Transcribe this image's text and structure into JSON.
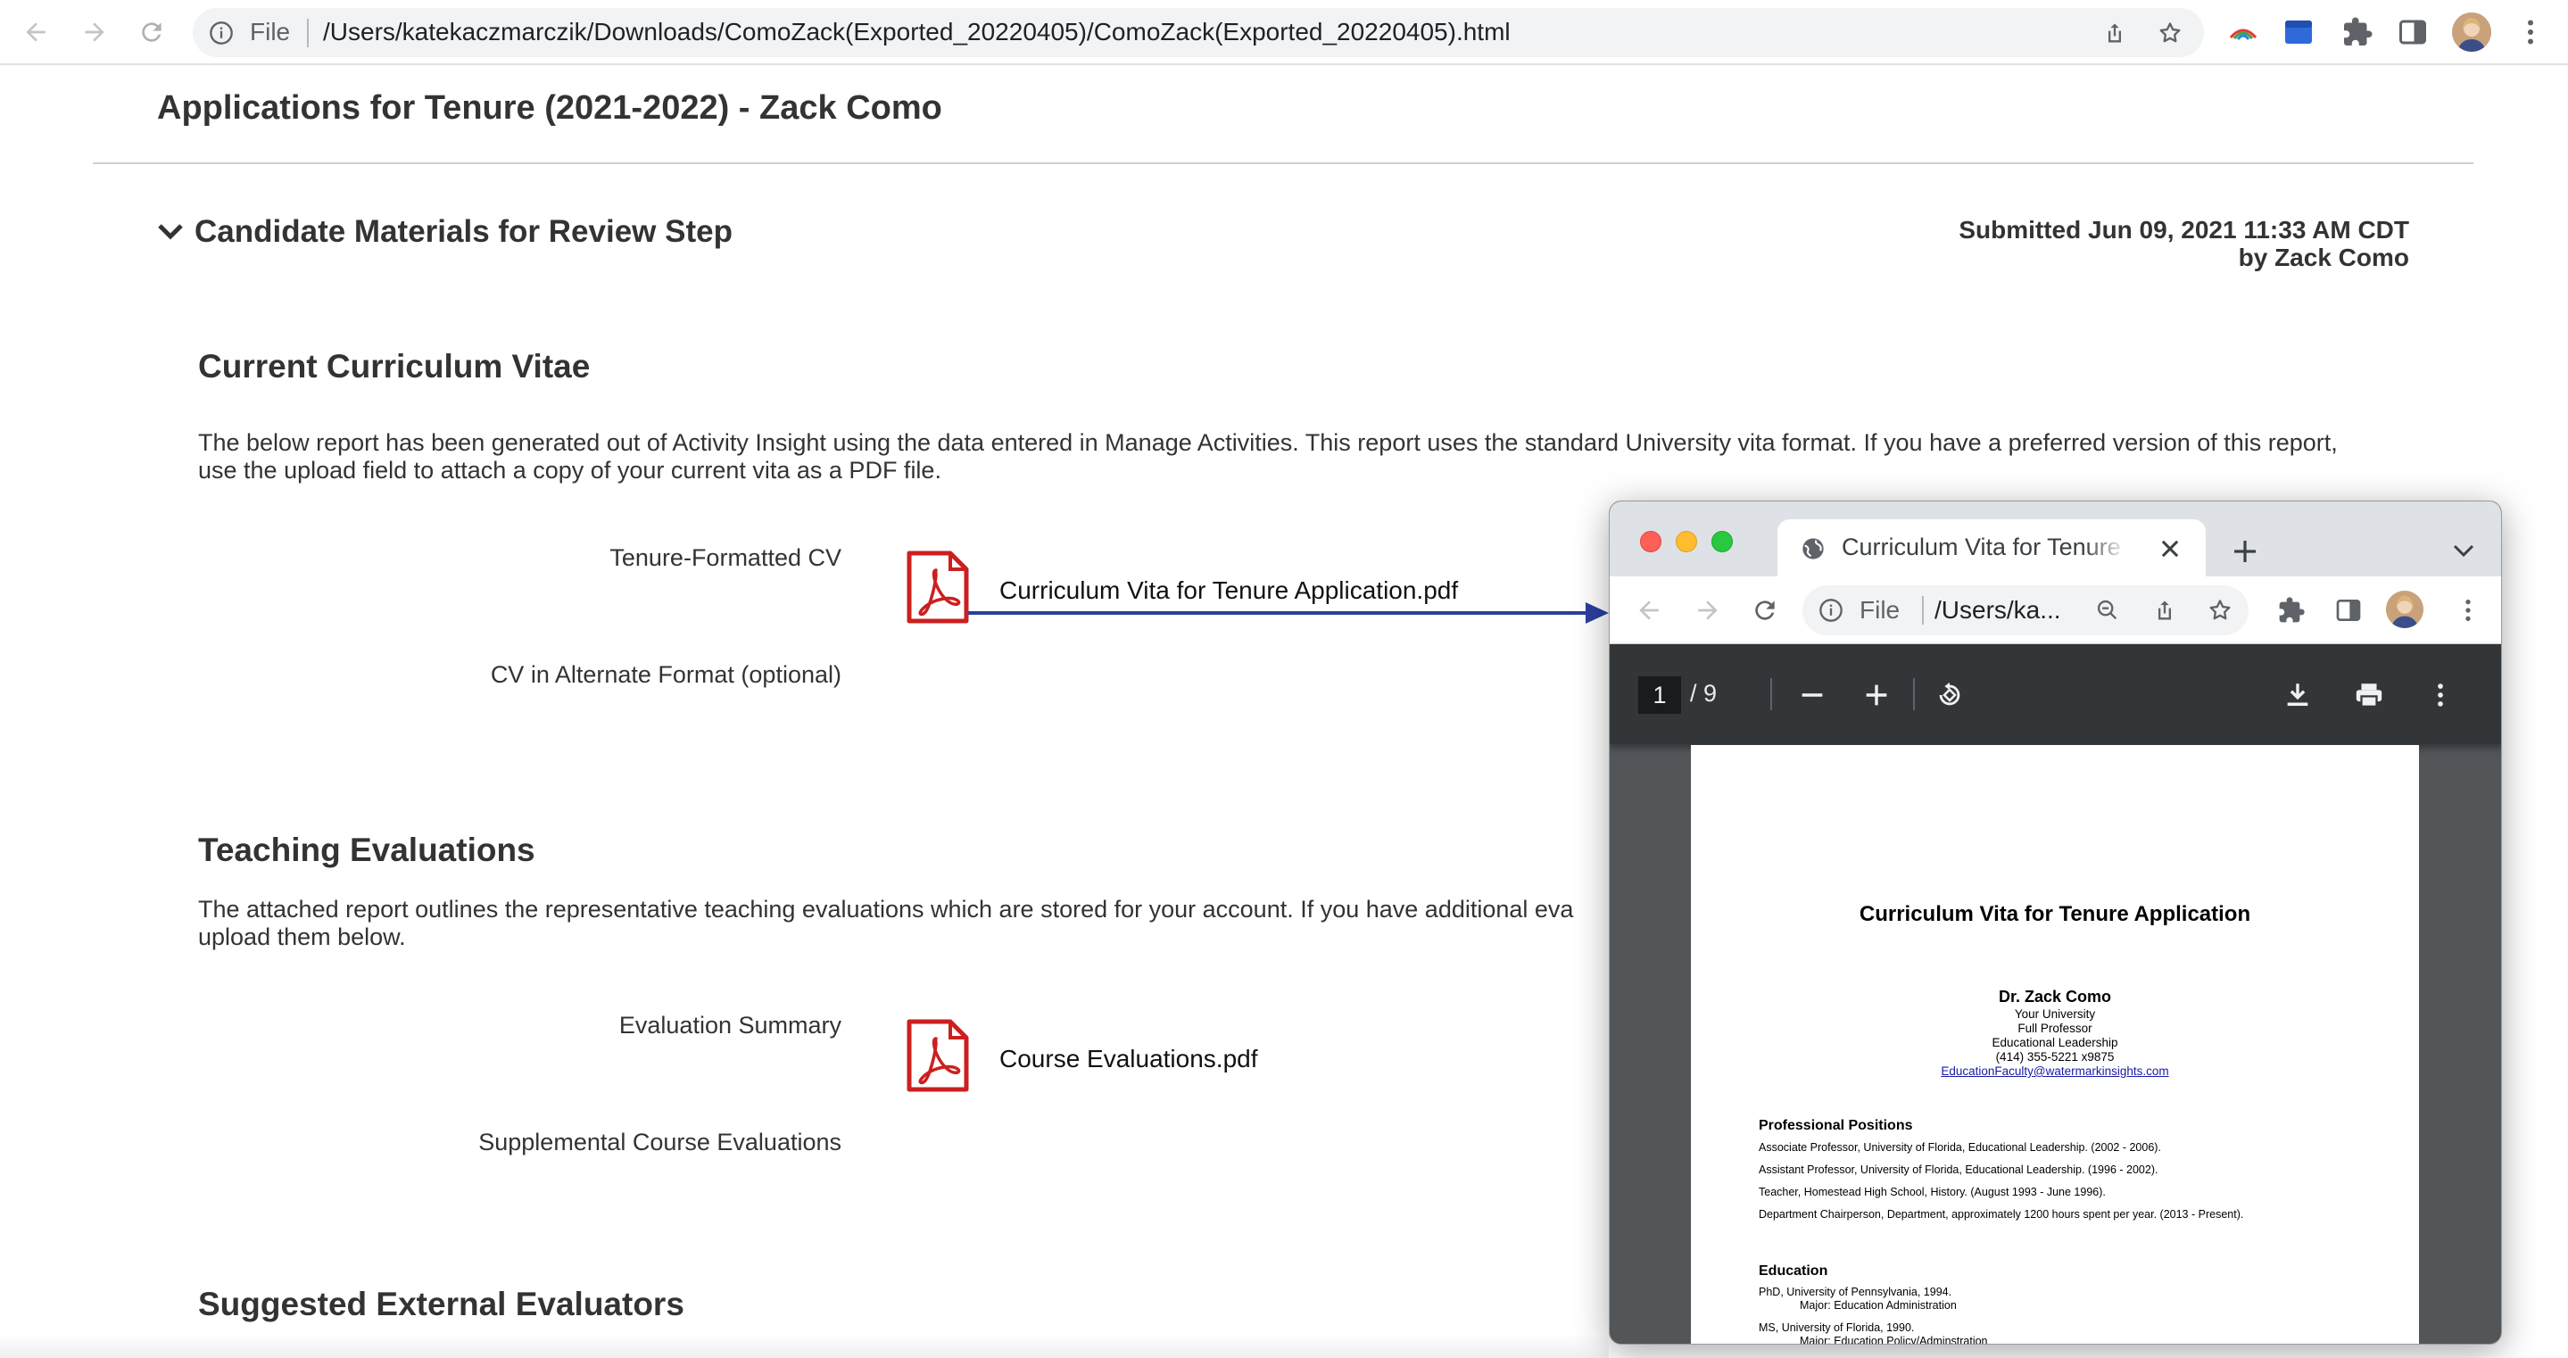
{
  "browser": {
    "omnibox_scheme": "File",
    "url": "/Users/katekaczmarczik/Downloads/ComoZack(Exported_20220405)/ComoZack(Exported_20220405).html"
  },
  "page": {
    "title": "Applications for Tenure (2021-2022) - Zack Como",
    "section_title": "Candidate Materials for Review Step",
    "submitted_line1": "Submitted Jun 09, 2021 11:33 AM CDT",
    "submitted_line2": "by Zack Como",
    "cv": {
      "heading": "Current Curriculum Vitae",
      "description": "The below report has been generated out of Activity Insight using the data entered in Manage Activities. This report uses the standard University vita format. If you have a preferred version of this report, use the upload field to attach a copy of your current vita as a PDF file.",
      "field1_label": "Tenure-Formatted CV",
      "field1_file": "Curriculum Vita for Tenure Application.pdf",
      "field2_label": "CV in Alternate Format (optional)"
    },
    "teaching": {
      "heading": "Teaching Evaluations",
      "description": "The attached report outlines the representative teaching evaluations which are stored for your account. If you have additional eva upload them below.",
      "field1_label": "Evaluation Summary",
      "field1_file": "Course Evaluations.pdf",
      "field2_label": "Supplemental Course Evaluations"
    },
    "external": {
      "heading": "Suggested External Evaluators"
    }
  },
  "popup": {
    "tab_title": "Curriculum Vita for Tenure Application.pdf",
    "omnibox_scheme": "File",
    "omnibox_url": "/Users/ka...",
    "pdf_viewer": {
      "current_page": "1",
      "total_pages": "/  9"
    },
    "document": {
      "title": "Curriculum Vita for Tenure Application",
      "name": "Dr. Zack Como",
      "lines": [
        "Your University",
        "Full Professor",
        "Educational Leadership",
        "(414) 355-5221 x9875"
      ],
      "email": "EducationFaculty@watermarkinsights.com",
      "positions_heading": "Professional Positions",
      "positions": [
        "Associate Professor, University of Florida, Educational Leadership. (2002 - 2006).",
        "Assistant Professor, University of Florida, Educational Leadership. (1996 - 2002).",
        "Teacher, Homestead High School, History. (August 1993 - June 1996).",
        "Department Chairperson, Department, approximately 1200 hours spent per year. (2013 - Present)."
      ],
      "education_heading": "Education",
      "education": [
        "PhD, University of Pennsylvania, 1994.",
        "Major: Education Administration",
        "MS, University of Florida, 1990.",
        "Major: Education Policy/Adminstration"
      ]
    }
  },
  "colors": {
    "pdf_red": "#cc1f1f",
    "arrow_blue": "#2b3f9e",
    "pdf_toolbar": "#323639",
    "viewer_bg": "#525659"
  }
}
